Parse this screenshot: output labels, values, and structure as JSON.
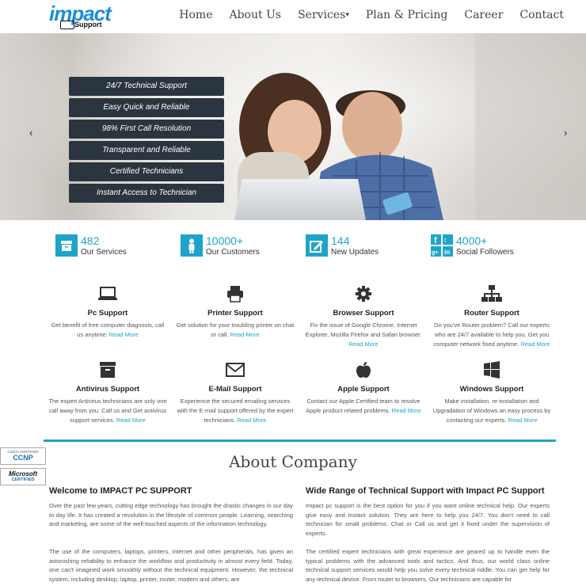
{
  "logo": {
    "main": "impact",
    "sub": "Support",
    "pc": "PC"
  },
  "nav": {
    "home": "Home",
    "about": "About Us",
    "services": "Services",
    "pricing": "Plan & Pricing",
    "career": "Career",
    "contact": "Contact"
  },
  "hero": {
    "features": [
      "24/7 Technical Support",
      "Easy Quick and Reliable",
      "98% First Call Resolution",
      "Transparent and Reliable",
      "Certified Technicians",
      "Instant Access to Technician"
    ],
    "prev": "‹",
    "next": "›"
  },
  "stats": [
    {
      "number": "482",
      "label": "Our Services",
      "icon": "archive-icon"
    },
    {
      "number": "10000+",
      "label": "Our Customers",
      "icon": "user-icon"
    },
    {
      "number": "144",
      "label": "New Updates",
      "icon": "edit-icon"
    },
    {
      "number": "4000+",
      "label": "Social Followers",
      "icon": "social-icon"
    }
  ],
  "services": [
    {
      "title": "Pc Support",
      "desc": "Get benefit of free computer diagnosis, call us anytime.",
      "more": "Read More",
      "icon": "laptop-icon"
    },
    {
      "title": "Printer Support",
      "desc": "Get solution for your troubling printer on chat or call.",
      "more": "Read More",
      "icon": "printer-icon"
    },
    {
      "title": "Browser Support",
      "desc": "Fix the issue of Google Chrome, Internet Explorer, Mozilla Firefox and Safari browser.",
      "more": "Read More",
      "icon": "gear-icon"
    },
    {
      "title": "Router Support",
      "desc": "Do you've Router problem? Call our experts who are 24/7 available to help you. Get you computer network fixed anytime.",
      "more": "Read More",
      "icon": "network-icon"
    },
    {
      "title": "Antivirus Support",
      "desc": "The expert Antivirus technicians are only one call away from you. Call us and Get antivirus support services.",
      "more": "Read More",
      "icon": "archive-icon"
    },
    {
      "title": "E-Mail Support",
      "desc": "Experience the secured emailing services with the E-mail support offered by the expert technicians.",
      "more": "Read More",
      "icon": "envelope-icon"
    },
    {
      "title": "Apple Support",
      "desc": "Contact our Apple Certified team to resolve Apple product related problems.",
      "more": "Read More",
      "icon": "apple-icon"
    },
    {
      "title": "Windows Support",
      "desc": "Make installation, re-installation and Upgradation of Windows an easy process by contacting our experts.",
      "more": "Read More",
      "icon": "windows-icon"
    }
  ],
  "badges": {
    "ccnp_top": "CISCO CERTIFIED",
    "ccnp": "CCNP",
    "ms_top": "Microsoft",
    "ms": "CERTIFIED"
  },
  "about": {
    "title": "About Company",
    "left_title": "Welcome to IMPACT PC SUPPORT",
    "left_p1": "Over the past few years, cutting edge technology has brought the drastic changes in our day to day life. It has created a revolution in the lifestyle of common people. Learning, searching and marketing, are some of the well-touched aspects of the information technology.",
    "left_p2": "The use of the computers, laptops, printers, internet and other peripherals, has given an astonishing reliability to enhance the workflow and productivity in almost every field. Today, one can't imagined work smoothly without the technical equipment. However, the technical system, including desktop, laptop, printer, router, modem and others, are",
    "right_title": "Wide Range of Technical Support with Impact PC Support",
    "right_p1": "Impact pc support is the best option for you if you want online technical help. Our experts give easy and instant solution. They are here to help you 24/7. You don't need to call technician for small problems. Chat or Call us and get it fixed under the supervision of experts.",
    "right_p2": "The certified expert technicians with great experience are geared up to handle even the typical problems with the advanced tools and tactics. And thus, our world class online technical support services would help you solve every technical riddle. You can get help for any technical device. From router to browsers. Our technicians are capable for"
  },
  "colors": {
    "accent": "#1fa4c9",
    "hero_box": "#2b3540"
  }
}
